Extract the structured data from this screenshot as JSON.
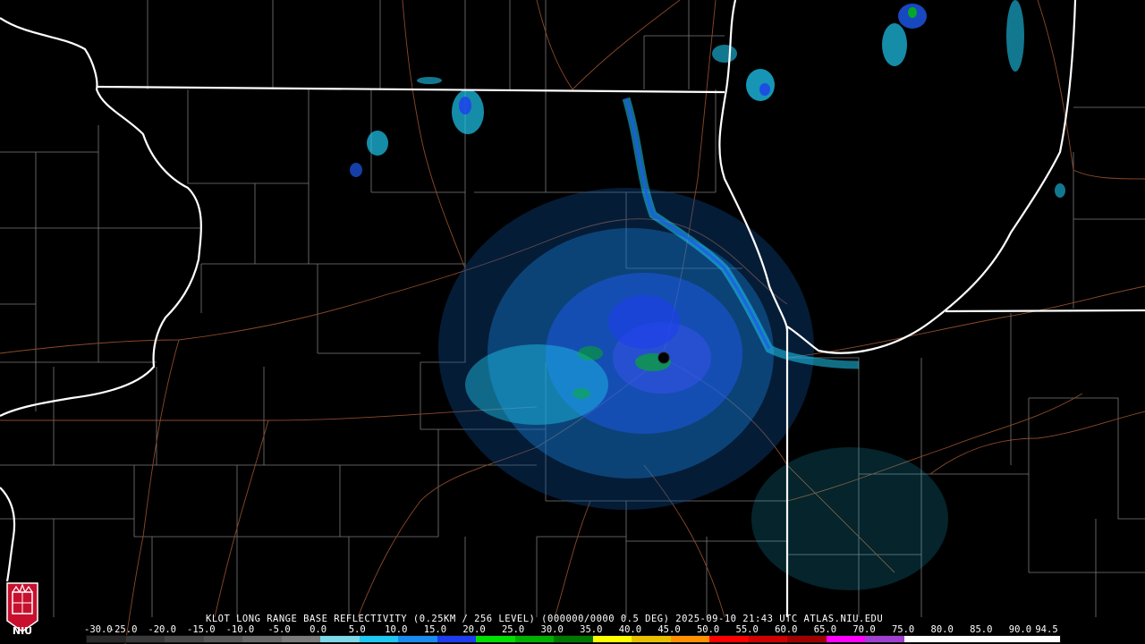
{
  "product": {
    "title": "KLOT LONG RANGE BASE REFLECTIVITY (0.25KM / 256 LEVEL) (000000/0000 0.5 DEG) 2025-09-10 21:43 UTC  ATLAS.NIU.EDU"
  },
  "radar": {
    "site": "KLOT"
  },
  "logo": {
    "text": "NIU",
    "color": "#c8102e"
  },
  "colorscale": {
    "labels": [
      "-30.0",
      "-25.0",
      "-20.0",
      "-15.0",
      "-10.0",
      "-5.0",
      "0.0",
      "5.0",
      "10.0",
      "15.0",
      "20.0",
      "25.0",
      "30.0",
      "35.0",
      "40.0",
      "45.0",
      "50.0",
      "55.0",
      "60.0",
      "65.0",
      "70.0",
      "75.0",
      "80.0",
      "85.0",
      "90.0",
      "94.5"
    ],
    "colors": [
      "#2a2a2a",
      "#3a3a3a",
      "#4a4a4a",
      "#5a5a5a",
      "#6a6a6a",
      "#7c7c7c",
      "#7ed8e8",
      "#1ec8f0",
      "#1a8cf0",
      "#1e3cf0",
      "#00e000",
      "#00b000",
      "#007800",
      "#ffff00",
      "#e8c000",
      "#ff9000",
      "#ff0000",
      "#d00000",
      "#a00000",
      "#ff00ff",
      "#a040d0",
      "#ffffff",
      "#ffffff",
      "#ffffff",
      "#ffffff"
    ]
  },
  "colors": {
    "background": "#000000",
    "state_lines": "#ffffff",
    "county_lines": "#8a8a8a",
    "roads": "#8b4a2a"
  }
}
